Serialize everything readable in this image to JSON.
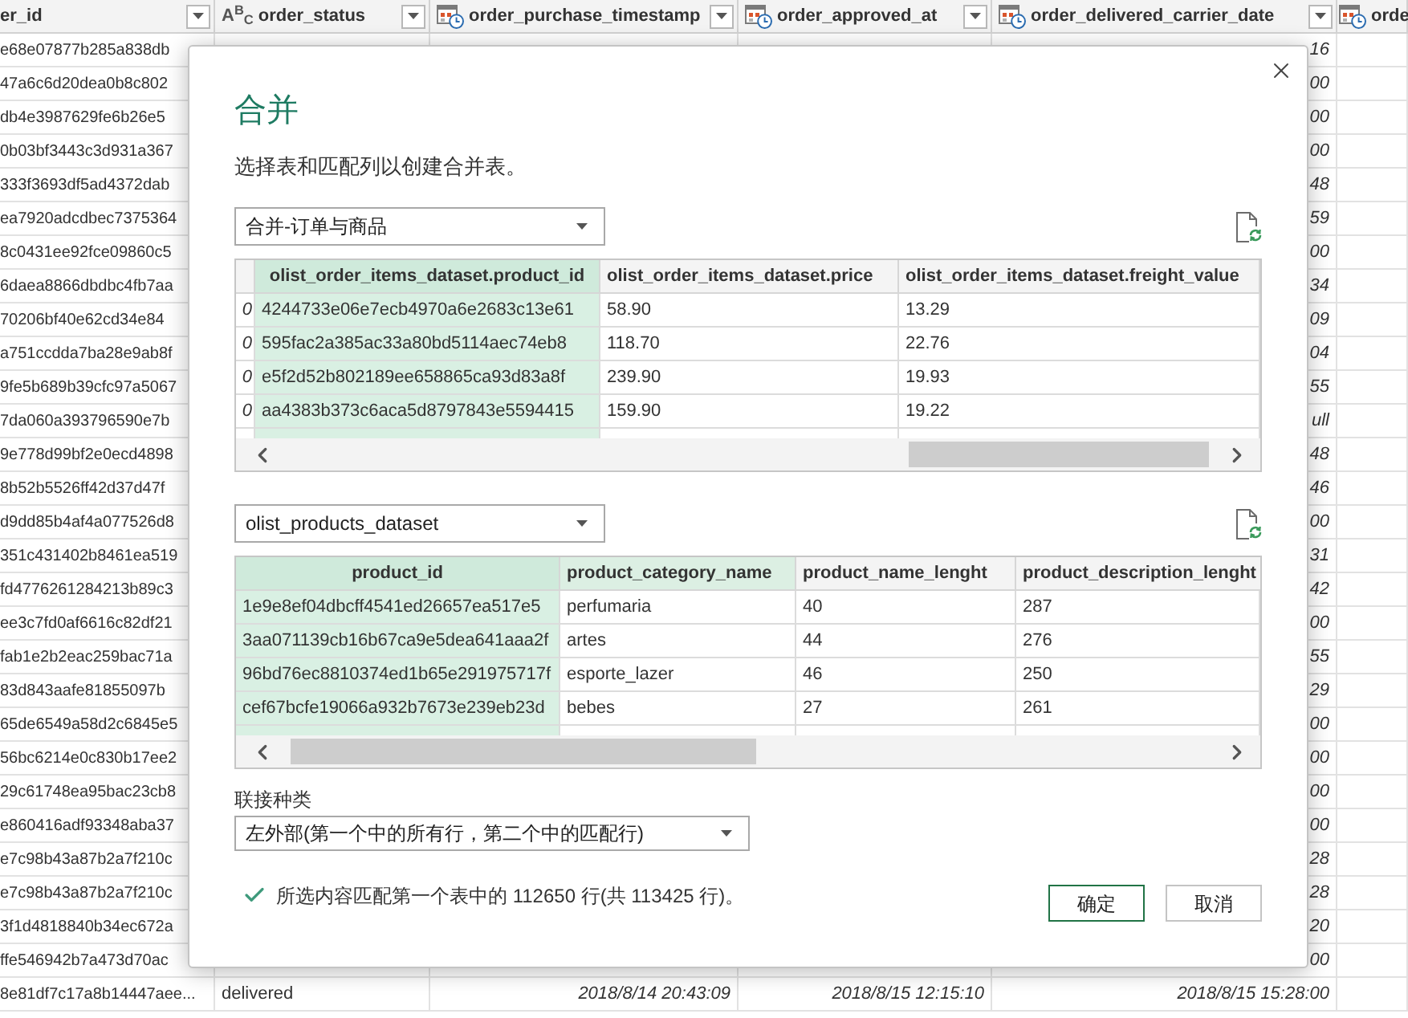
{
  "data_grid": {
    "columns": [
      {
        "label": "er_id",
        "filter_button": true
      },
      {
        "label": "order_status",
        "kind": "text",
        "type_label": "A$^{B}$$_{C}$",
        "filter_button": true
      },
      {
        "label": "order_purchase_timestamp",
        "kind": "datetime",
        "filter_button": true
      },
      {
        "label": "order_approved_at",
        "kind": "datetime",
        "filter_button": true
      },
      {
        "label": "order_delivered_carrier_date",
        "kind": "datetime",
        "filter_button": true
      },
      {
        "label": "orde",
        "kind": "datetime",
        "filter_button": false
      }
    ],
    "rows": [
      {
        "column_1": "e68e07877b285a838db",
        "order_delivered_carrier_date": "16"
      },
      {
        "column_1": "47a6c6d20dea0b8c802",
        "order_delivered_carrier_date": "00"
      },
      {
        "column_1": "db4e3987629fe6b26e5",
        "order_delivered_carrier_date": "00"
      },
      {
        "column_1": "0b03bf3443c3d931a367",
        "order_delivered_carrier_date": "00"
      },
      {
        "column_1": "333f3693df5ad4372dab",
        "order_delivered_carrier_date": "48"
      },
      {
        "column_1": "ea7920adcdbec7375364",
        "order_delivered_carrier_date": "59"
      },
      {
        "column_1": "8c0431ee92fce09860c5",
        "order_delivered_carrier_date": "00"
      },
      {
        "column_1": "6daea8866dbdbc4fb7aa",
        "order_delivered_carrier_date": "34"
      },
      {
        "column_1": "70206bf40e62cd34e84",
        "order_delivered_carrier_date": "09"
      },
      {
        "column_1": "a751ccdda7ba28e9ab8f",
        "order_delivered_carrier_date": "04"
      },
      {
        "column_1": "9fe5b689b39cfc97a5067",
        "order_delivered_carrier_date": "55"
      },
      {
        "column_1": "7da060a393796590e7b",
        "order_delivered_carrier_date": "ull"
      },
      {
        "column_1": "9e778d99bf2e0ecd4898",
        "order_delivered_carrier_date": "48"
      },
      {
        "column_1": "8b52b5526ff42d37d47f",
        "order_delivered_carrier_date": "46"
      },
      {
        "column_1": "d9dd85b4af4a077526d8",
        "order_delivered_carrier_date": "00"
      },
      {
        "column_1": "351c431402b8461ea519",
        "order_delivered_carrier_date": "31"
      },
      {
        "column_1": "fd4776261284213b89c3",
        "order_delivered_carrier_date": "42"
      },
      {
        "column_1": "ee3c7fd0af6616c82df21",
        "order_delivered_carrier_date": "00"
      },
      {
        "column_1": "fab1e2b2eac259bac71a",
        "order_delivered_carrier_date": "55"
      },
      {
        "column_1": "83d843aafe81855097b",
        "order_delivered_carrier_date": "29"
      },
      {
        "column_1": "65de6549a58d2c6845e5",
        "order_delivered_carrier_date": "00"
      },
      {
        "column_1": "56bc6214e0c830b17ee2",
        "order_delivered_carrier_date": "00"
      },
      {
        "column_1": "29c61748ea95bac23cb8",
        "order_delivered_carrier_date": "00"
      },
      {
        "column_1": "e860416adf93348aba37",
        "order_delivered_carrier_date": "00"
      },
      {
        "column_1": "e7c98b43a87b2a7f210c",
        "order_delivered_carrier_date": "28"
      },
      {
        "column_1": "e7c98b43a87b2a7f210c",
        "order_delivered_carrier_date": "28"
      },
      {
        "column_1": "3f1d4818840b34ec672a",
        "order_delivered_carrier_date": "20"
      },
      {
        "column_1": "ffe546942b7a473d70ac",
        "order_delivered_carrier_date": "00"
      },
      {
        "column_1": "8e81df7c17a8b14447aee...",
        "order_status": "delivered",
        "order_purchase_timestamp": "2018/8/14 20:43:09",
        "order_approved_at": "2018/8/15 12:15:10",
        "order_delivered_carrier_date": "2018/8/15 15:28:00"
      }
    ]
  },
  "dialog": {
    "title": "合并",
    "description": "选择表和匹配列以创建合并表。",
    "first_table": {
      "source": "合并-订单与商品",
      "cut_off_column": {
        "cells": [
          "0",
          "0",
          "0",
          "0"
        ]
      },
      "columns": [
        {
          "header": "olist_order_items_dataset.product_id",
          "selected": true,
          "hovered": false
        },
        {
          "header": "olist_order_items_dataset.price",
          "selected": false,
          "hovered": false
        },
        {
          "header": "olist_order_items_dataset.freight_value",
          "selected": false,
          "hovered": false
        }
      ],
      "rows": [
        [
          "4244733e06e7ecb4970a6e2683c13e61",
          "58.90",
          "13.29"
        ],
        [
          "595fac2a385ac33a80bd5114aec74eb8",
          "118.70",
          "22.76"
        ],
        [
          "e5f2d52b802189ee658865ca93d83a8f",
          "239.90",
          "19.93"
        ],
        [
          "aa4383b373c6aca5d8797843e5594415",
          "159.90",
          "19.22"
        ]
      ]
    },
    "second_table": {
      "source": "olist_products_dataset",
      "columns": [
        {
          "header": "product_id",
          "selected": true,
          "hovered": false
        },
        {
          "header": "product_category_name",
          "selected": false,
          "hovered": true
        },
        {
          "header": "product_name_lenght",
          "selected": false,
          "hovered": false
        },
        {
          "header": "product_description_lenght",
          "selected": false,
          "hovered": false
        }
      ],
      "rows": [
        [
          "1e9e8ef04dbcff4541ed26657ea517e5",
          "perfumaria",
          "40",
          "287"
        ],
        [
          "3aa071139cb16b67ca9e5dea641aaa2f",
          "artes",
          "44",
          "276"
        ],
        [
          "96bd76ec8810374ed1b65e291975717f",
          "esporte_lazer",
          "46",
          "250"
        ],
        [
          "cef67bcfe19066a932b7673e239eb23d",
          "bebes",
          "27",
          "261"
        ]
      ]
    },
    "join_kind": {
      "label": "联接种类",
      "value": "左外部(第一个中的所有行，第二个中的匹配行)"
    },
    "match_status": {
      "kind": "success",
      "text": "所选内容匹配第一个表中的 112650 行(共 113425 行)。"
    },
    "buttons": [
      {
        "label": "确定",
        "default": true
      },
      {
        "label": "取消",
        "default": false
      }
    ]
  }
}
